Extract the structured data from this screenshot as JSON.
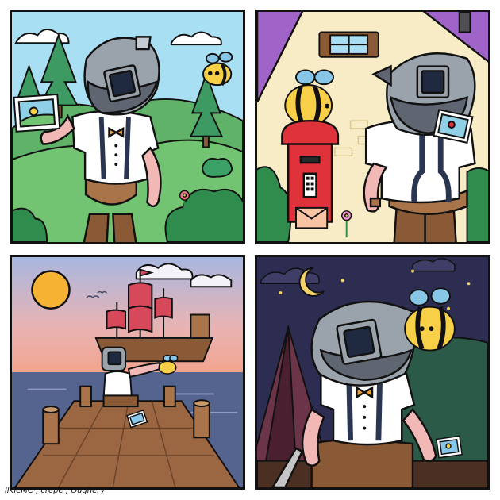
{
  "comic": {
    "credit": "llkieMC , crepe , Oughery"
  },
  "colors": {
    "outline": "#111111",
    "sky_day": "#a9dff2",
    "grass": "#73c472",
    "tree_green": "#3c9a62",
    "bush": "#2f8c4c",
    "house_wall": "#f8ecc6",
    "roof": "#a064c8",
    "postbox": "#e0323a",
    "sunset_sky_top": "#a8b7e0",
    "sunset_sky_bottom": "#f3a48d",
    "sea": "#55648f",
    "sun": "#f6b233",
    "sail": "#d8485b",
    "hull": "#8a5a36",
    "dock": "#9a6742",
    "night_sky": "#2d2d52",
    "moon": "#f4d36a",
    "tent": "#6c3448",
    "bee_yellow": "#f7d048",
    "bee_wing": "#88c6e8",
    "camera_head": "#9aa2ac",
    "screen": "#1f2a40",
    "shirt": "#ffffff",
    "suspenders": "#2a3550",
    "bowtie": "#f2a12e",
    "pants": "#8a5a36",
    "skin": "#f2b8b6"
  },
  "icons": [
    "camera-head-character",
    "bee-character",
    "photo-card",
    "postbox",
    "letter-envelope",
    "ship",
    "sun",
    "moon",
    "star",
    "tent"
  ]
}
